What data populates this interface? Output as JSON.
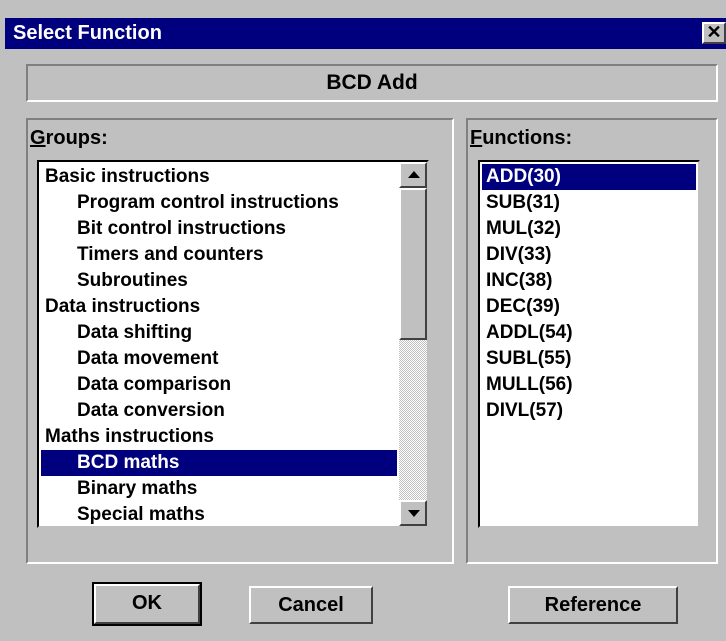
{
  "window": {
    "title": "Select Function",
    "close_glyph": "✕"
  },
  "selected_function_name": "BCD Add",
  "groups": {
    "label_accel": "G",
    "label_rest": "roups:",
    "items": [
      {
        "label": "Basic instructions",
        "level": 0,
        "selected": false
      },
      {
        "label": "Program control instructions",
        "level": 1,
        "selected": false
      },
      {
        "label": "Bit control instructions",
        "level": 1,
        "selected": false
      },
      {
        "label": "Timers and counters",
        "level": 1,
        "selected": false
      },
      {
        "label": "Subroutines",
        "level": 1,
        "selected": false
      },
      {
        "label": "Data instructions",
        "level": 0,
        "selected": false
      },
      {
        "label": "Data shifting",
        "level": 1,
        "selected": false
      },
      {
        "label": "Data movement",
        "level": 1,
        "selected": false
      },
      {
        "label": "Data comparison",
        "level": 1,
        "selected": false
      },
      {
        "label": "Data conversion",
        "level": 1,
        "selected": false
      },
      {
        "label": "Maths instructions",
        "level": 0,
        "selected": false
      },
      {
        "label": "BCD maths",
        "level": 1,
        "selected": true
      },
      {
        "label": "Binary maths",
        "level": 1,
        "selected": false
      },
      {
        "label": "Special maths",
        "level": 1,
        "selected": false
      }
    ]
  },
  "functions": {
    "label_accel": "F",
    "label_rest": "unctions:",
    "items": [
      {
        "label": "ADD(30)",
        "selected": true
      },
      {
        "label": "SUB(31)",
        "selected": false
      },
      {
        "label": "MUL(32)",
        "selected": false
      },
      {
        "label": "DIV(33)",
        "selected": false
      },
      {
        "label": "INC(38)",
        "selected": false
      },
      {
        "label": "DEC(39)",
        "selected": false
      },
      {
        "label": "ADDL(54)",
        "selected": false
      },
      {
        "label": "SUBL(55)",
        "selected": false
      },
      {
        "label": "MULL(56)",
        "selected": false
      },
      {
        "label": "DIVL(57)",
        "selected": false
      }
    ]
  },
  "buttons": {
    "ok": "OK",
    "cancel": "Cancel",
    "reference": "Reference"
  },
  "colors": {
    "titlebar": "#00007f",
    "face": "#c0c0c0",
    "selection": "#00007f"
  }
}
